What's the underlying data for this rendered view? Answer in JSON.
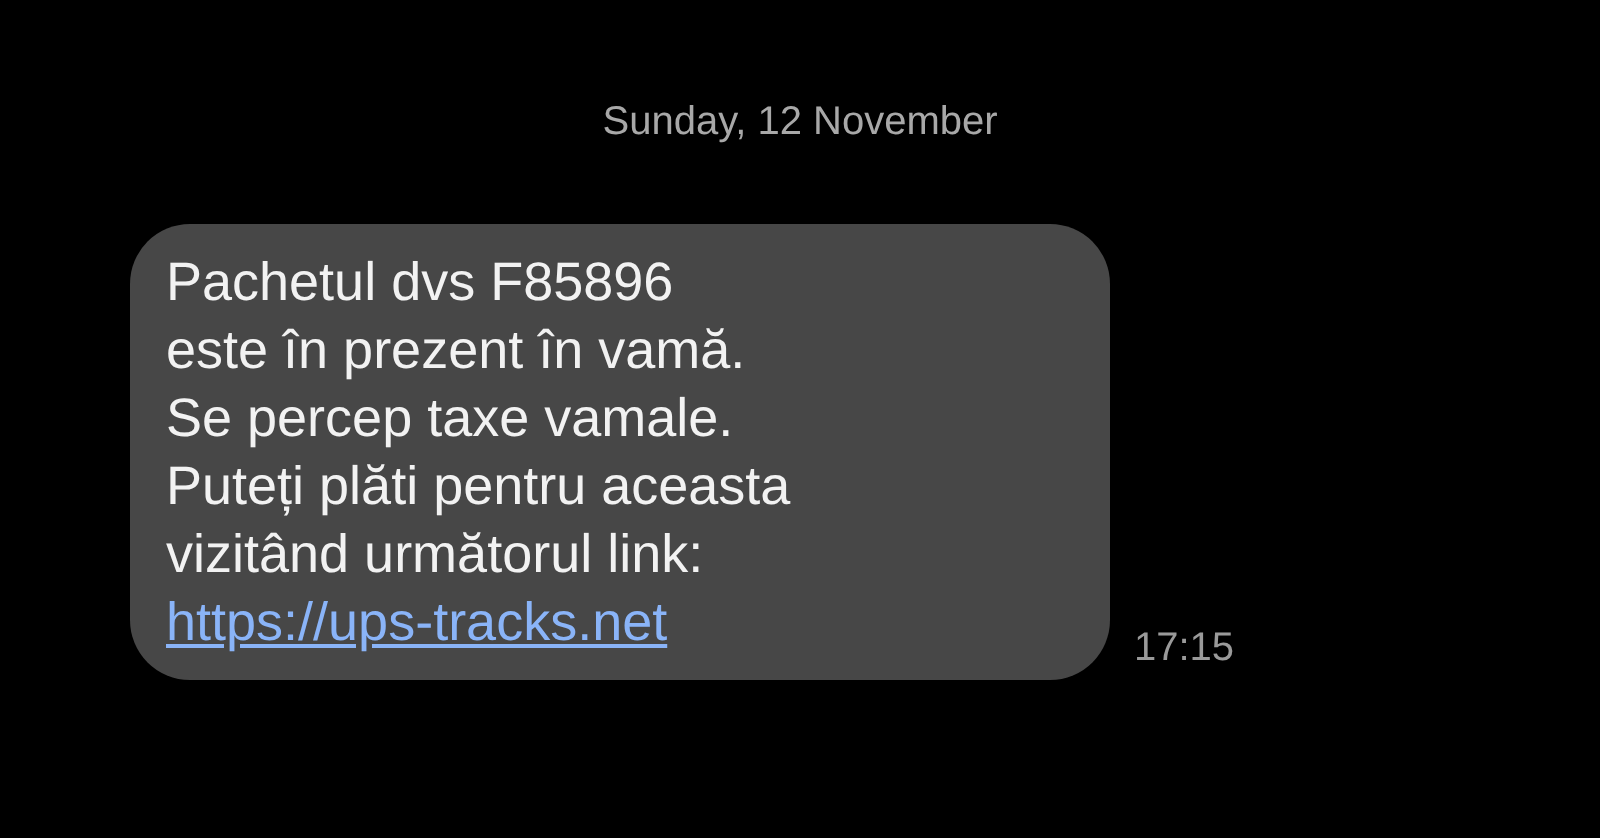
{
  "date_header": "Sunday, 12 November",
  "message": {
    "lines": [
      "Pachetul dvs F85896",
      "este în prezent în vamă.",
      "Se percep taxe vamale.",
      "Puteți plăti pentru aceasta",
      "vizitând următorul link:"
    ],
    "link": "https://ups-tracks.net",
    "time": "17:15"
  }
}
